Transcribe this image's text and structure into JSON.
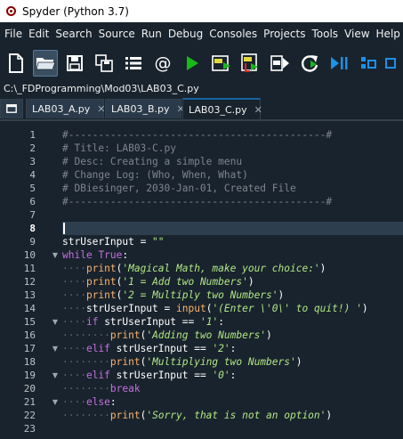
{
  "window": {
    "title": "Spyder (Python 3.7)"
  },
  "menubar": {
    "items": [
      {
        "id": "file",
        "label": "File"
      },
      {
        "id": "edit",
        "label": "Edit"
      },
      {
        "id": "search",
        "label": "Search"
      },
      {
        "id": "source",
        "label": "Source"
      },
      {
        "id": "run",
        "label": "Run"
      },
      {
        "id": "debug",
        "label": "Debug"
      },
      {
        "id": "consoles",
        "label": "Consoles"
      },
      {
        "id": "projects",
        "label": "Projects"
      },
      {
        "id": "tools",
        "label": "Tools"
      },
      {
        "id": "view",
        "label": "View"
      },
      {
        "id": "help",
        "label": "Help"
      }
    ]
  },
  "toolbar": {
    "buttons": [
      {
        "id": "new-file",
        "icon": "new-file-icon"
      },
      {
        "id": "open-file",
        "icon": "open-folder-icon",
        "active": true
      },
      {
        "id": "save-file",
        "icon": "save-icon"
      },
      {
        "id": "save-all",
        "icon": "save-all-icon"
      },
      {
        "id": "browse-tabs",
        "icon": "list-icon"
      },
      {
        "id": "email",
        "icon": "at-sign-icon"
      },
      {
        "id": "run-file",
        "icon": "run-icon"
      },
      {
        "id": "run-cell",
        "icon": "run-cell-icon"
      },
      {
        "id": "run-cell-advance",
        "icon": "run-cell-advance-icon"
      },
      {
        "id": "run-selection",
        "icon": "run-selection-icon"
      },
      {
        "id": "rerun",
        "icon": "rerun-icon"
      },
      {
        "id": "debug-step",
        "icon": "debug-continue-icon"
      },
      {
        "id": "layout",
        "icon": "layout-icon"
      },
      {
        "id": "more",
        "icon": "more-icon"
      }
    ]
  },
  "path": "C:\\_FDProgramming\\Mod03\\LAB03_C.py",
  "tabs": [
    {
      "label": "LAB03_A.py",
      "active": false
    },
    {
      "label": "LAB03_B.py",
      "active": false
    },
    {
      "label": "LAB03_C.py",
      "active": true
    }
  ],
  "editor": {
    "current_line": 8,
    "lines": [
      {
        "n": "1",
        "fold": "",
        "tokens": [
          [
            "c-comment",
            "#-------------------------------------------#"
          ]
        ]
      },
      {
        "n": "2",
        "fold": "",
        "tokens": [
          [
            "c-comment",
            "# Title: LAB03-C.py"
          ]
        ]
      },
      {
        "n": "3",
        "fold": "",
        "tokens": [
          [
            "c-comment",
            "# Desc: Creating a simple menu"
          ]
        ]
      },
      {
        "n": "4",
        "fold": "",
        "tokens": [
          [
            "c-comment",
            "# Change Log: (Who, When, What)"
          ]
        ]
      },
      {
        "n": "5",
        "fold": "",
        "tokens": [
          [
            "c-comment",
            "# DBiesinger, 2030-Jan-01, Created File"
          ]
        ]
      },
      {
        "n": "6",
        "fold": "",
        "tokens": [
          [
            "c-comment",
            "#-------------------------------------------#"
          ]
        ]
      },
      {
        "n": "7",
        "fold": "",
        "tokens": []
      },
      {
        "n": "8",
        "fold": "",
        "tokens": []
      },
      {
        "n": "9",
        "fold": "",
        "tokens": [
          [
            "c-id",
            "strUserInput"
          ],
          [
            "c-op",
            " = "
          ],
          [
            "c-str",
            "\"\""
          ]
        ]
      },
      {
        "n": "10",
        "fold": "▼",
        "tokens": [
          [
            "c-kw",
            "while"
          ],
          [
            "c-op",
            " "
          ],
          [
            "c-kw",
            "True"
          ],
          [
            "c-op",
            ":"
          ]
        ]
      },
      {
        "n": "11",
        "fold": "",
        "tokens": [
          [
            "c-ws",
            "····"
          ],
          [
            "c-fn",
            "print"
          ],
          [
            "c-op",
            "("
          ],
          [
            "c-str",
            "'Magical Math, make your choice:'"
          ],
          [
            "c-op",
            ")"
          ]
        ]
      },
      {
        "n": "12",
        "fold": "",
        "tokens": [
          [
            "c-ws",
            "····"
          ],
          [
            "c-fn",
            "print"
          ],
          [
            "c-op",
            "("
          ],
          [
            "c-str",
            "'1 = Add two Numbers'"
          ],
          [
            "c-op",
            ")"
          ]
        ]
      },
      {
        "n": "13",
        "fold": "",
        "tokens": [
          [
            "c-ws",
            "····"
          ],
          [
            "c-fn",
            "print"
          ],
          [
            "c-op",
            "("
          ],
          [
            "c-str",
            "'2 = Multiply two Numbers'"
          ],
          [
            "c-op",
            ")"
          ]
        ]
      },
      {
        "n": "14",
        "fold": "",
        "tokens": [
          [
            "c-ws",
            "····"
          ],
          [
            "c-id",
            "strUserInput"
          ],
          [
            "c-op",
            " = "
          ],
          [
            "c-fn",
            "input"
          ],
          [
            "c-op",
            "("
          ],
          [
            "c-str",
            "'(Enter \\'0\\' to quit!) '"
          ],
          [
            "c-op",
            ")"
          ]
        ]
      },
      {
        "n": "15",
        "fold": "▼",
        "tokens": [
          [
            "c-ws",
            "····"
          ],
          [
            "c-kw",
            "if"
          ],
          [
            "c-op",
            " "
          ],
          [
            "c-id",
            "strUserInput"
          ],
          [
            "c-op",
            " == "
          ],
          [
            "c-str",
            "'1'"
          ],
          [
            "c-op",
            ":"
          ]
        ]
      },
      {
        "n": "16",
        "fold": "",
        "tokens": [
          [
            "c-ws",
            "········"
          ],
          [
            "c-fn",
            "print"
          ],
          [
            "c-op",
            "("
          ],
          [
            "c-str",
            "'Adding two Numbers'"
          ],
          [
            "c-op",
            ")"
          ]
        ]
      },
      {
        "n": "17",
        "fold": "▼",
        "tokens": [
          [
            "c-ws",
            "····"
          ],
          [
            "c-kw",
            "elif"
          ],
          [
            "c-op",
            " "
          ],
          [
            "c-id",
            "strUserInput"
          ],
          [
            "c-op",
            " == "
          ],
          [
            "c-str",
            "'2'"
          ],
          [
            "c-op",
            ":"
          ]
        ]
      },
      {
        "n": "18",
        "fold": "",
        "tokens": [
          [
            "c-ws",
            "········"
          ],
          [
            "c-fn",
            "print"
          ],
          [
            "c-op",
            "("
          ],
          [
            "c-str",
            "'Multiplying two Numbers'"
          ],
          [
            "c-op",
            ")"
          ]
        ]
      },
      {
        "n": "19",
        "fold": "▼",
        "tokens": [
          [
            "c-ws",
            "····"
          ],
          [
            "c-kw",
            "elif"
          ],
          [
            "c-op",
            " "
          ],
          [
            "c-id",
            "strUserInput"
          ],
          [
            "c-op",
            " == "
          ],
          [
            "c-str",
            "'0'"
          ],
          [
            "c-op",
            ":"
          ]
        ]
      },
      {
        "n": "20",
        "fold": "",
        "tokens": [
          [
            "c-ws",
            "········"
          ],
          [
            "c-kw",
            "break"
          ]
        ]
      },
      {
        "n": "21",
        "fold": "▼",
        "tokens": [
          [
            "c-ws",
            "····"
          ],
          [
            "c-kw",
            "else"
          ],
          [
            "c-op",
            ":"
          ]
        ]
      },
      {
        "n": "22",
        "fold": "",
        "tokens": [
          [
            "c-ws",
            "········"
          ],
          [
            "c-fn",
            "print"
          ],
          [
            "c-op",
            "("
          ],
          [
            "c-str",
            "'Sorry, that is not an option'"
          ],
          [
            "c-op",
            ")"
          ]
        ]
      },
      {
        "n": "23",
        "fold": "",
        "tokens": []
      }
    ]
  }
}
